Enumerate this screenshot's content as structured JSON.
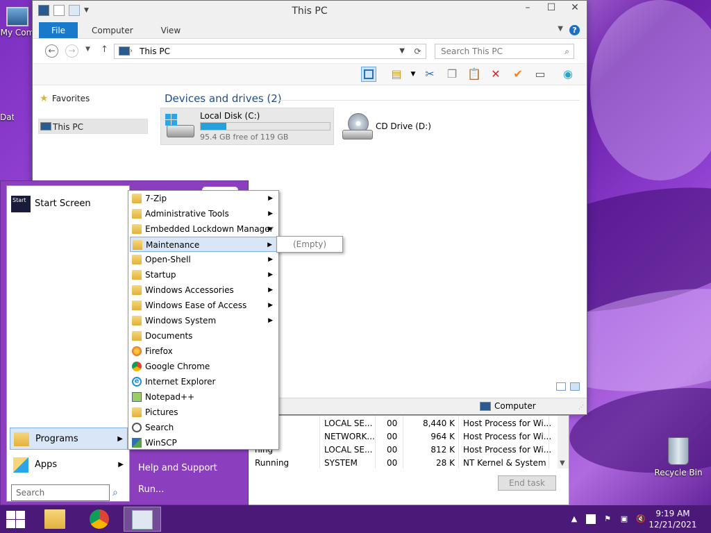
{
  "desktop": {
    "my_computer_label": "My Com",
    "recycle_label": "Recycle Bin",
    "partial_label": "Dat"
  },
  "explorer": {
    "title": "This PC",
    "ribbon_tabs": [
      "File",
      "Computer",
      "View"
    ],
    "address": "This PC",
    "search_placeholder": "Search This PC",
    "nav": {
      "favorites": "Favorites",
      "this_pc": "This PC"
    },
    "section_title": "Devices and drives (2)",
    "drives": [
      {
        "name": "Local Disk (C:)",
        "free": "95.4 GB free of 119 GB",
        "used_fraction": 0.2
      },
      {
        "name": "CD Drive (D:)"
      }
    ],
    "status_location": "Computer"
  },
  "task_manager": {
    "rows": [
      {
        "status": "ning",
        "user": "LOCAL SE...",
        "cpu": "00",
        "mem": "8,440 K",
        "desc": "Host Process for Wi..."
      },
      {
        "status": "ning",
        "user": "NETWORK...",
        "cpu": "00",
        "mem": "964 K",
        "desc": "Host Process for Wi..."
      },
      {
        "status": "ning",
        "user": "LOCAL SE...",
        "cpu": "00",
        "mem": "812 K",
        "desc": "Host Process for Wi..."
      },
      {
        "status": "Running",
        "user": "SYSTEM",
        "cpu": "00",
        "mem": "28 K",
        "desc": "NT Kernel & System"
      }
    ],
    "end_task_label": "End task"
  },
  "start_menu": {
    "start_screen": "Start Screen",
    "start_screen_icon_text": "Start",
    "programs": "Programs",
    "apps": "Apps",
    "search_placeholder": "Search",
    "help": "Help and Support",
    "run": "Run..."
  },
  "programs_menu": {
    "items": [
      {
        "label": "7-Zip",
        "type": "folder",
        "submenu": true
      },
      {
        "label": "Administrative Tools",
        "type": "folder",
        "submenu": true
      },
      {
        "label": "Embedded Lockdown Manager",
        "type": "folder",
        "submenu": true
      },
      {
        "label": "Maintenance",
        "type": "folder",
        "submenu": true,
        "highlighted": true
      },
      {
        "label": "Open-Shell",
        "type": "folder",
        "submenu": true
      },
      {
        "label": "Startup",
        "type": "folder",
        "submenu": true
      },
      {
        "label": "Windows Accessories",
        "type": "folder",
        "submenu": true
      },
      {
        "label": "Windows Ease of Access",
        "type": "folder",
        "submenu": true
      },
      {
        "label": "Windows System",
        "type": "folder",
        "submenu": true
      },
      {
        "label": "Documents",
        "type": "folder"
      },
      {
        "label": "Firefox",
        "type": "firefox"
      },
      {
        "label": "Google Chrome",
        "type": "chrome"
      },
      {
        "label": "Internet Explorer",
        "type": "ie"
      },
      {
        "label": "Notepad++",
        "type": "npp"
      },
      {
        "label": "Pictures",
        "type": "folder"
      },
      {
        "label": "Search",
        "type": "search"
      },
      {
        "label": "WinSCP",
        "type": "winscp"
      }
    ],
    "empty_label": "(Empty)"
  },
  "taskbar": {
    "time": "9:19 AM",
    "date": "12/21/2021"
  }
}
